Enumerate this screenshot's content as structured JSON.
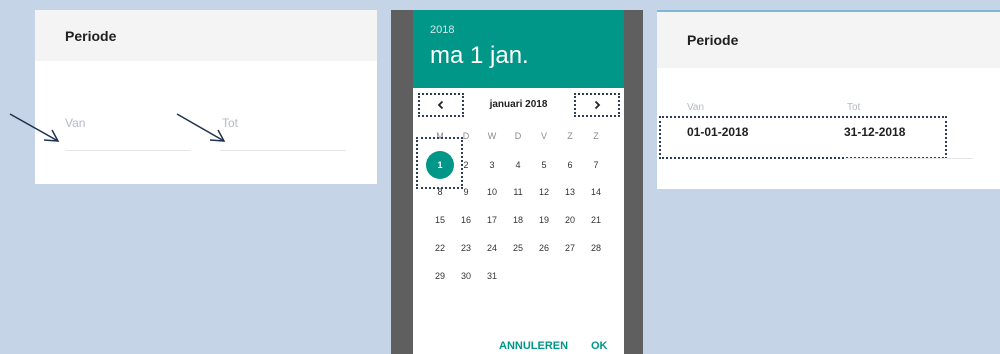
{
  "left_panel": {
    "title": "Periode",
    "van_label": "Van",
    "tot_label": "Tot"
  },
  "picker": {
    "year": "2018",
    "selected_date": "ma 1 jan.",
    "month_label": "januari 2018",
    "prev_icon": "chevron-left-icon",
    "next_icon": "chevron-right-icon",
    "weekdays": [
      "M",
      "D",
      "W",
      "D",
      "V",
      "Z",
      "Z"
    ],
    "weeks": [
      [
        "1",
        "2",
        "3",
        "4",
        "5",
        "6",
        "7"
      ],
      [
        "8",
        "9",
        "10",
        "11",
        "12",
        "13",
        "14"
      ],
      [
        "15",
        "16",
        "17",
        "18",
        "19",
        "20",
        "21"
      ],
      [
        "22",
        "23",
        "24",
        "25",
        "26",
        "27",
        "28"
      ],
      [
        "29",
        "30",
        "31",
        "",
        "",
        "",
        ""
      ]
    ],
    "selected_day": "1",
    "cancel_label": "ANNULEREN",
    "ok_label": "OK",
    "accent_color": "#009688"
  },
  "right_panel": {
    "title": "Periode",
    "van_label": "Van",
    "tot_label": "Tot",
    "van_value": "01-01-2018",
    "tot_value": "31-12-2018"
  },
  "background_color": "#c5d4e7",
  "annotation_color": "#2c3e5a"
}
